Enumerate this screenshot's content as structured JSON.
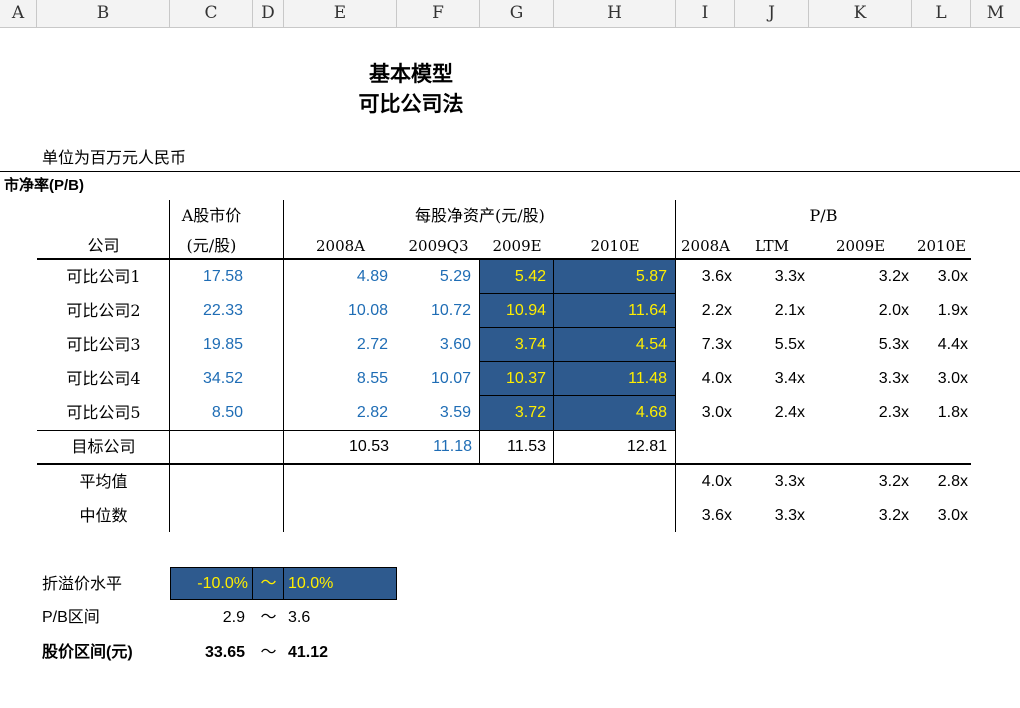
{
  "column_headers": [
    "A",
    "B",
    "C",
    "D",
    "E",
    "F",
    "G",
    "H",
    "I",
    "J",
    "K",
    "L",
    "M"
  ],
  "title_line1": "基本模型",
  "title_line2": "可比公司法",
  "unit_note": "单位为百万元人民币",
  "section_title": "市净率(P/B)",
  "header": {
    "a_price_l1": "A股市价",
    "a_price_l2": "(元/股)",
    "company": "公司",
    "bvps": "每股净资产(元/股)",
    "pb": "P/B",
    "bv_cols": [
      "2008A",
      "2009Q3",
      "2009E",
      "2010E"
    ],
    "pb_cols": [
      "2008A",
      "LTM",
      "2009E",
      "2010E"
    ]
  },
  "comps": [
    {
      "name": "可比公司1",
      "price": "17.58",
      "bv": [
        "4.89",
        "5.29",
        "5.42",
        "5.87"
      ],
      "pb": [
        "3.6x",
        "3.3x",
        "3.2x",
        "3.0x"
      ]
    },
    {
      "name": "可比公司2",
      "price": "22.33",
      "bv": [
        "10.08",
        "10.72",
        "10.94",
        "11.64"
      ],
      "pb": [
        "2.2x",
        "2.1x",
        "2.0x",
        "1.9x"
      ]
    },
    {
      "name": "可比公司3",
      "price": "19.85",
      "bv": [
        "2.72",
        "3.60",
        "3.74",
        "4.54"
      ],
      "pb": [
        "7.3x",
        "5.5x",
        "5.3x",
        "4.4x"
      ]
    },
    {
      "name": "可比公司4",
      "price": "34.52",
      "bv": [
        "8.55",
        "10.07",
        "10.37",
        "11.48"
      ],
      "pb": [
        "4.0x",
        "3.4x",
        "3.3x",
        "3.0x"
      ]
    },
    {
      "name": "可比公司5",
      "price": "8.50",
      "bv": [
        "2.82",
        "3.59",
        "3.72",
        "4.68"
      ],
      "pb": [
        "3.0x",
        "2.4x",
        "2.3x",
        "1.8x"
      ]
    }
  ],
  "target": {
    "name": "目标公司",
    "bv": [
      "10.53",
      "11.18",
      "11.53",
      "12.81"
    ]
  },
  "average": {
    "label": "平均值",
    "pb": [
      "4.0x",
      "3.3x",
      "3.2x",
      "2.8x"
    ]
  },
  "median": {
    "label": "中位数",
    "pb": [
      "3.6x",
      "3.3x",
      "3.2x",
      "3.0x"
    ]
  },
  "discount": {
    "label": "折溢价水平",
    "low": "-10.0%",
    "tilde": "～",
    "high": "10.0%"
  },
  "pb_range": {
    "label": "P/B区间",
    "low": "2.9",
    "tilde": "～",
    "high": "3.6"
  },
  "price_range": {
    "label": "股价区间(元)",
    "low": "33.65",
    "tilde": "～",
    "high": "41.12"
  },
  "colors": {
    "highlight_fill": "#2e5a8e",
    "input_blue": "#1f6db5",
    "highlight_text": "#ffee00"
  }
}
